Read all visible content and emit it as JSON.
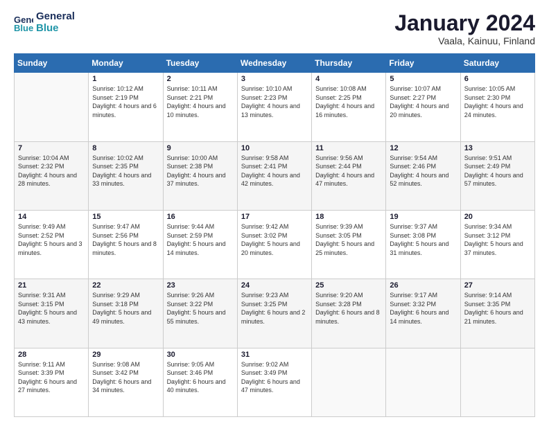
{
  "header": {
    "logo_line1": "General",
    "logo_line2": "Blue",
    "month": "January 2024",
    "location": "Vaala, Kainuu, Finland"
  },
  "days_of_week": [
    "Sunday",
    "Monday",
    "Tuesday",
    "Wednesday",
    "Thursday",
    "Friday",
    "Saturday"
  ],
  "weeks": [
    [
      {
        "day": "",
        "sunrise": "",
        "sunset": "",
        "daylight": ""
      },
      {
        "day": "1",
        "sunrise": "Sunrise: 10:12 AM",
        "sunset": "Sunset: 2:19 PM",
        "daylight": "Daylight: 4 hours and 6 minutes."
      },
      {
        "day": "2",
        "sunrise": "Sunrise: 10:11 AM",
        "sunset": "Sunset: 2:21 PM",
        "daylight": "Daylight: 4 hours and 10 minutes."
      },
      {
        "day": "3",
        "sunrise": "Sunrise: 10:10 AM",
        "sunset": "Sunset: 2:23 PM",
        "daylight": "Daylight: 4 hours and 13 minutes."
      },
      {
        "day": "4",
        "sunrise": "Sunrise: 10:08 AM",
        "sunset": "Sunset: 2:25 PM",
        "daylight": "Daylight: 4 hours and 16 minutes."
      },
      {
        "day": "5",
        "sunrise": "Sunrise: 10:07 AM",
        "sunset": "Sunset: 2:27 PM",
        "daylight": "Daylight: 4 hours and 20 minutes."
      },
      {
        "day": "6",
        "sunrise": "Sunrise: 10:05 AM",
        "sunset": "Sunset: 2:30 PM",
        "daylight": "Daylight: 4 hours and 24 minutes."
      }
    ],
    [
      {
        "day": "7",
        "sunrise": "Sunrise: 10:04 AM",
        "sunset": "Sunset: 2:32 PM",
        "daylight": "Daylight: 4 hours and 28 minutes."
      },
      {
        "day": "8",
        "sunrise": "Sunrise: 10:02 AM",
        "sunset": "Sunset: 2:35 PM",
        "daylight": "Daylight: 4 hours and 33 minutes."
      },
      {
        "day": "9",
        "sunrise": "Sunrise: 10:00 AM",
        "sunset": "Sunset: 2:38 PM",
        "daylight": "Daylight: 4 hours and 37 minutes."
      },
      {
        "day": "10",
        "sunrise": "Sunrise: 9:58 AM",
        "sunset": "Sunset: 2:41 PM",
        "daylight": "Daylight: 4 hours and 42 minutes."
      },
      {
        "day": "11",
        "sunrise": "Sunrise: 9:56 AM",
        "sunset": "Sunset: 2:44 PM",
        "daylight": "Daylight: 4 hours and 47 minutes."
      },
      {
        "day": "12",
        "sunrise": "Sunrise: 9:54 AM",
        "sunset": "Sunset: 2:46 PM",
        "daylight": "Daylight: 4 hours and 52 minutes."
      },
      {
        "day": "13",
        "sunrise": "Sunrise: 9:51 AM",
        "sunset": "Sunset: 2:49 PM",
        "daylight": "Daylight: 4 hours and 57 minutes."
      }
    ],
    [
      {
        "day": "14",
        "sunrise": "Sunrise: 9:49 AM",
        "sunset": "Sunset: 2:52 PM",
        "daylight": "Daylight: 5 hours and 3 minutes."
      },
      {
        "day": "15",
        "sunrise": "Sunrise: 9:47 AM",
        "sunset": "Sunset: 2:56 PM",
        "daylight": "Daylight: 5 hours and 8 minutes."
      },
      {
        "day": "16",
        "sunrise": "Sunrise: 9:44 AM",
        "sunset": "Sunset: 2:59 PM",
        "daylight": "Daylight: 5 hours and 14 minutes."
      },
      {
        "day": "17",
        "sunrise": "Sunrise: 9:42 AM",
        "sunset": "Sunset: 3:02 PM",
        "daylight": "Daylight: 5 hours and 20 minutes."
      },
      {
        "day": "18",
        "sunrise": "Sunrise: 9:39 AM",
        "sunset": "Sunset: 3:05 PM",
        "daylight": "Daylight: 5 hours and 25 minutes."
      },
      {
        "day": "19",
        "sunrise": "Sunrise: 9:37 AM",
        "sunset": "Sunset: 3:08 PM",
        "daylight": "Daylight: 5 hours and 31 minutes."
      },
      {
        "day": "20",
        "sunrise": "Sunrise: 9:34 AM",
        "sunset": "Sunset: 3:12 PM",
        "daylight": "Daylight: 5 hours and 37 minutes."
      }
    ],
    [
      {
        "day": "21",
        "sunrise": "Sunrise: 9:31 AM",
        "sunset": "Sunset: 3:15 PM",
        "daylight": "Daylight: 5 hours and 43 minutes."
      },
      {
        "day": "22",
        "sunrise": "Sunrise: 9:29 AM",
        "sunset": "Sunset: 3:18 PM",
        "daylight": "Daylight: 5 hours and 49 minutes."
      },
      {
        "day": "23",
        "sunrise": "Sunrise: 9:26 AM",
        "sunset": "Sunset: 3:22 PM",
        "daylight": "Daylight: 5 hours and 55 minutes."
      },
      {
        "day": "24",
        "sunrise": "Sunrise: 9:23 AM",
        "sunset": "Sunset: 3:25 PM",
        "daylight": "Daylight: 6 hours and 2 minutes."
      },
      {
        "day": "25",
        "sunrise": "Sunrise: 9:20 AM",
        "sunset": "Sunset: 3:28 PM",
        "daylight": "Daylight: 6 hours and 8 minutes."
      },
      {
        "day": "26",
        "sunrise": "Sunrise: 9:17 AM",
        "sunset": "Sunset: 3:32 PM",
        "daylight": "Daylight: 6 hours and 14 minutes."
      },
      {
        "day": "27",
        "sunrise": "Sunrise: 9:14 AM",
        "sunset": "Sunset: 3:35 PM",
        "daylight": "Daylight: 6 hours and 21 minutes."
      }
    ],
    [
      {
        "day": "28",
        "sunrise": "Sunrise: 9:11 AM",
        "sunset": "Sunset: 3:39 PM",
        "daylight": "Daylight: 6 hours and 27 minutes."
      },
      {
        "day": "29",
        "sunrise": "Sunrise: 9:08 AM",
        "sunset": "Sunset: 3:42 PM",
        "daylight": "Daylight: 6 hours and 34 minutes."
      },
      {
        "day": "30",
        "sunrise": "Sunrise: 9:05 AM",
        "sunset": "Sunset: 3:46 PM",
        "daylight": "Daylight: 6 hours and 40 minutes."
      },
      {
        "day": "31",
        "sunrise": "Sunrise: 9:02 AM",
        "sunset": "Sunset: 3:49 PM",
        "daylight": "Daylight: 6 hours and 47 minutes."
      },
      {
        "day": "",
        "sunrise": "",
        "sunset": "",
        "daylight": ""
      },
      {
        "day": "",
        "sunrise": "",
        "sunset": "",
        "daylight": ""
      },
      {
        "day": "",
        "sunrise": "",
        "sunset": "",
        "daylight": ""
      }
    ]
  ]
}
